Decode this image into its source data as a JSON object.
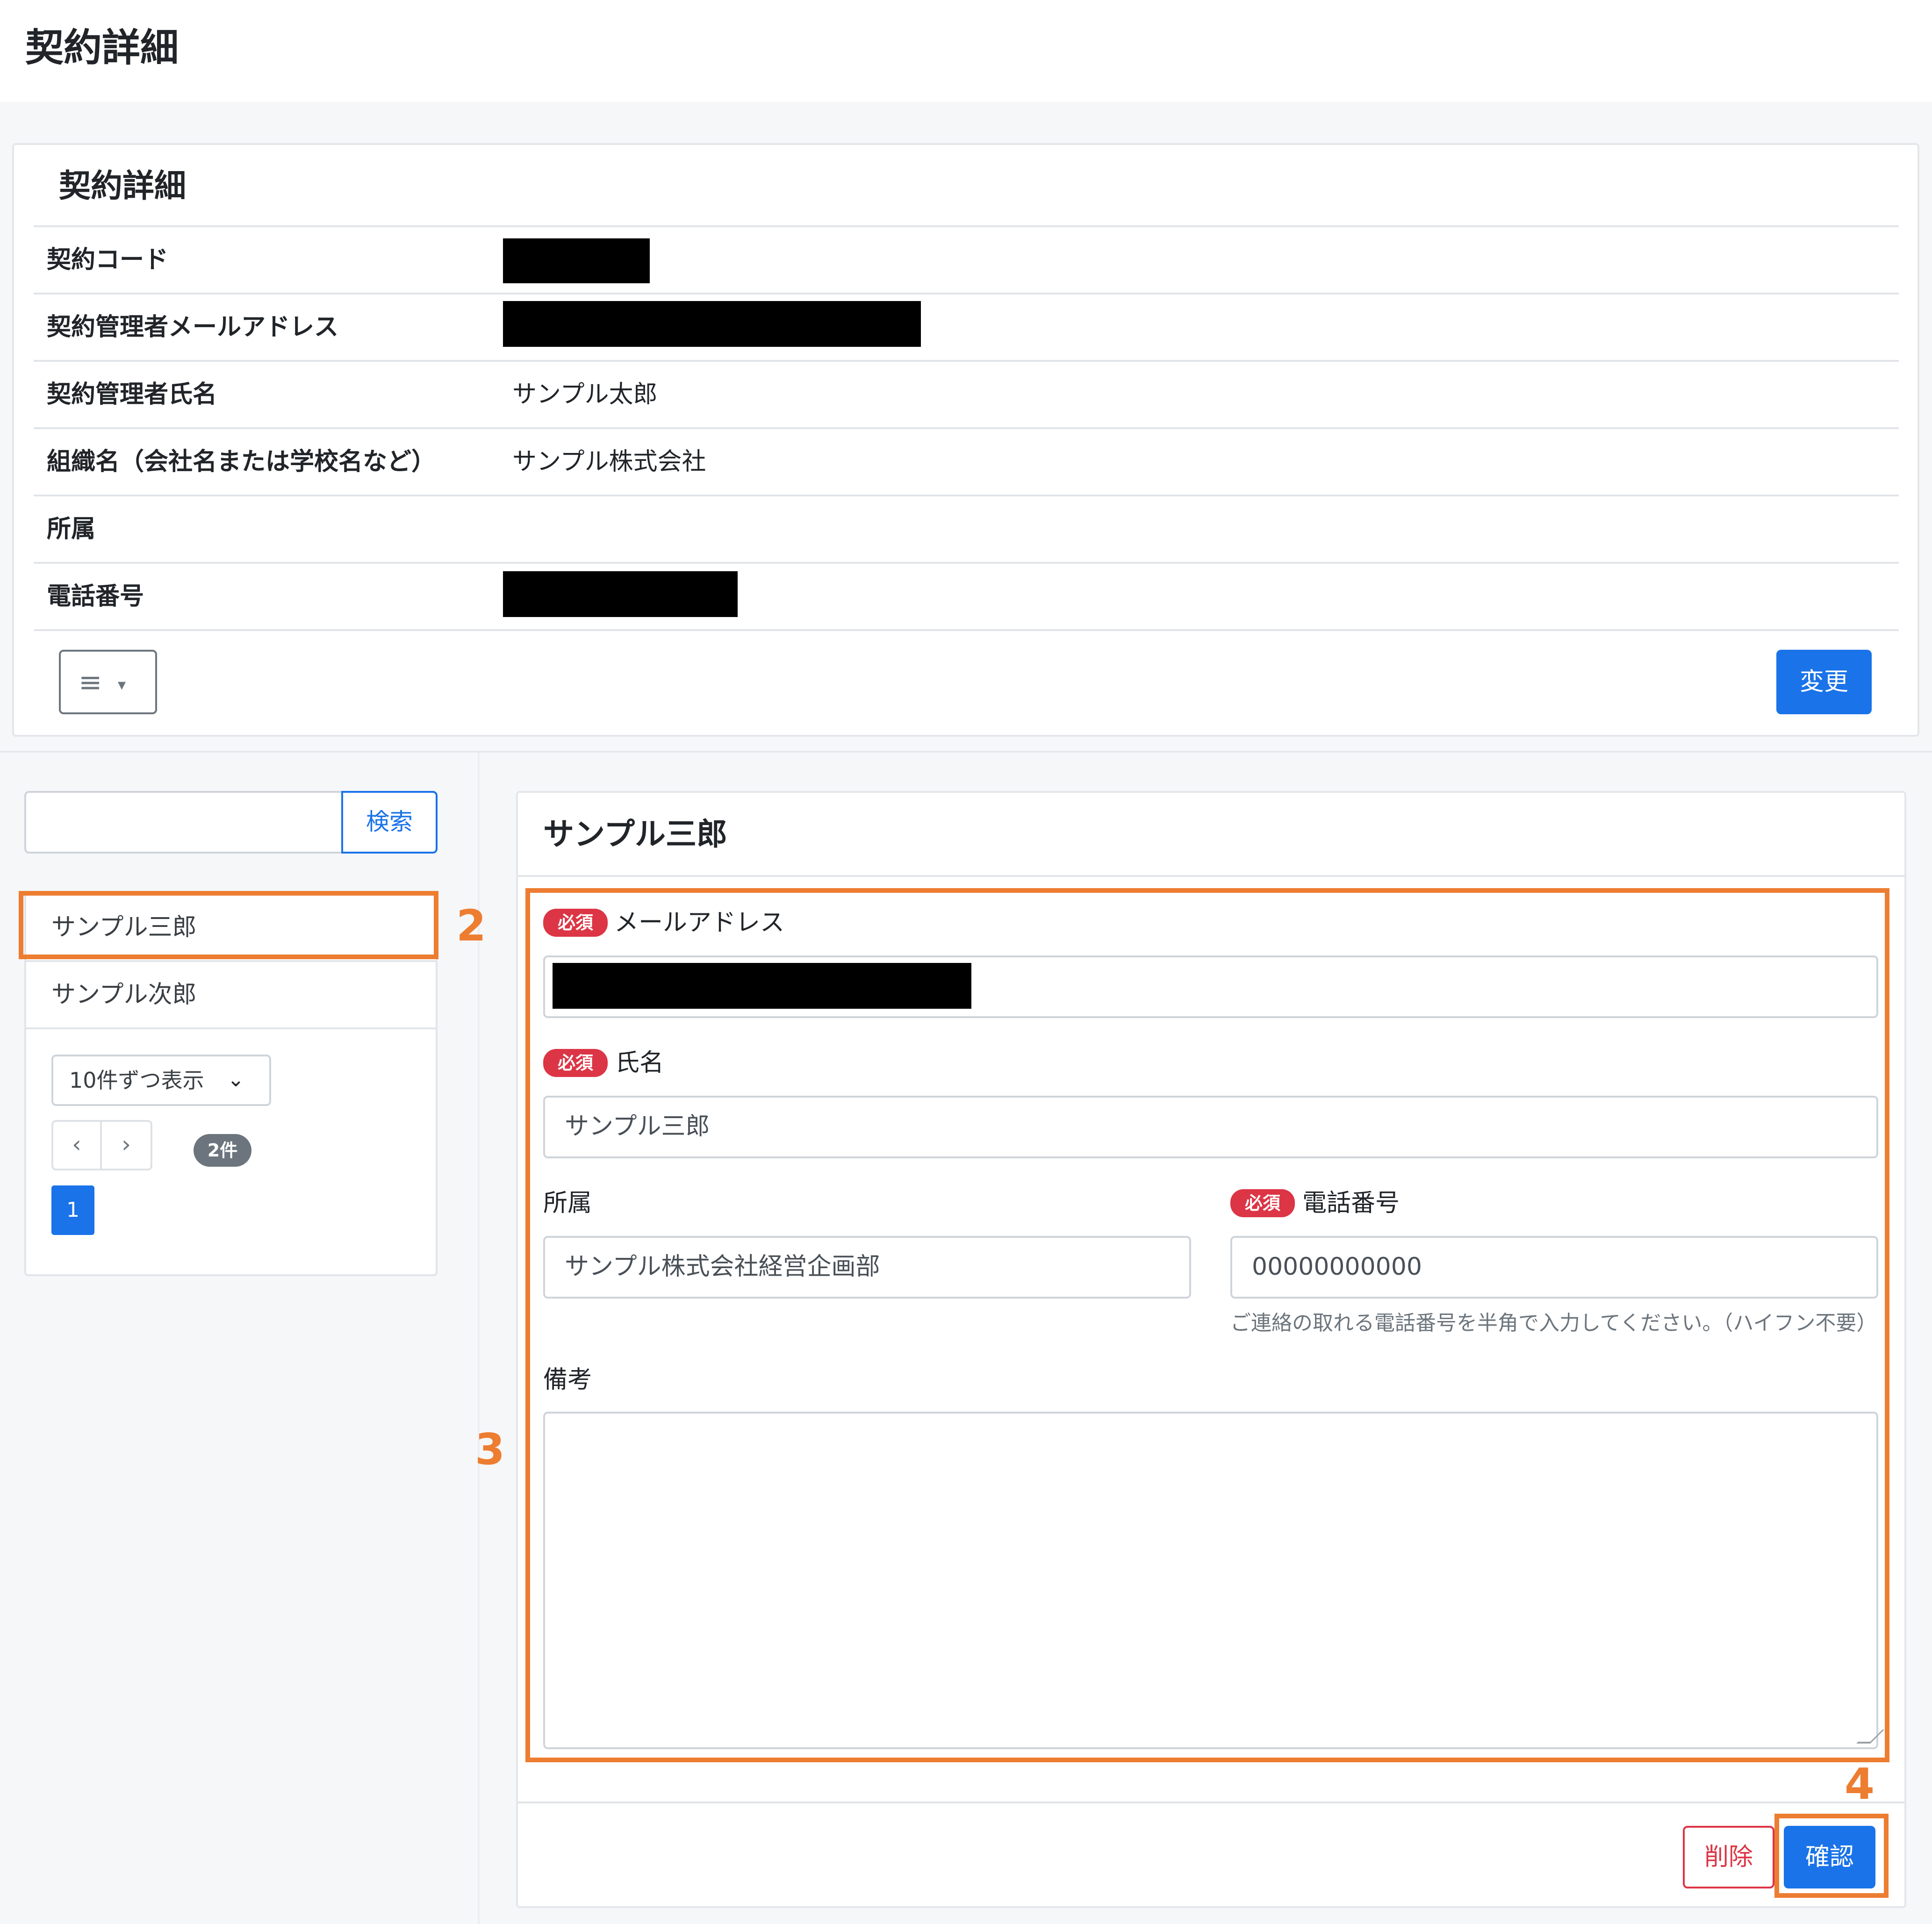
{
  "page": {
    "title": "契約詳細"
  },
  "contract": {
    "card_title": "契約詳細",
    "rows": [
      {
        "label": "契約コード",
        "value": ""
      },
      {
        "label": "契約管理者メールアドレス",
        "value": ""
      },
      {
        "label": "契約管理者氏名",
        "value": "サンプル太郎"
      },
      {
        "label": "組織名（会社名または学校名など）",
        "value": "サンプル株式会社"
      },
      {
        "label": "所属",
        "value": ""
      },
      {
        "label": "電話番号",
        "value": ""
      }
    ],
    "menu_icon": "≡",
    "menu_caret": "▾",
    "change_button": "変更"
  },
  "sidebar": {
    "search_button": "検索",
    "search_value": "",
    "items": [
      {
        "label": "サンプル三郎"
      },
      {
        "label": "サンプル次郎"
      }
    ],
    "page_size_select": "10件ずつ表示",
    "chevron": "⌄",
    "prev": "‹",
    "next": "›",
    "count_badge": "2件",
    "current_page": "1"
  },
  "form": {
    "title": "サンプル三郎",
    "required_badge": "必須",
    "email_label": "メールアドレス",
    "email_value": "",
    "name_label": "氏名",
    "name_value": "サンプル三郎",
    "dept_label": "所属",
    "dept_value": "サンプル株式会社経営企画部",
    "phone_label": "電話番号",
    "phone_value": "00000000000",
    "phone_help": "ご連絡の取れる電話番号を半角で入力してください。（ハイフン不要）",
    "notes_label": "備考",
    "notes_value": "",
    "delete_button": "削除",
    "confirm_button": "確認"
  },
  "annotations": {
    "step2": "2",
    "step3": "3",
    "step4": "4",
    "color": "#ed7d31"
  }
}
